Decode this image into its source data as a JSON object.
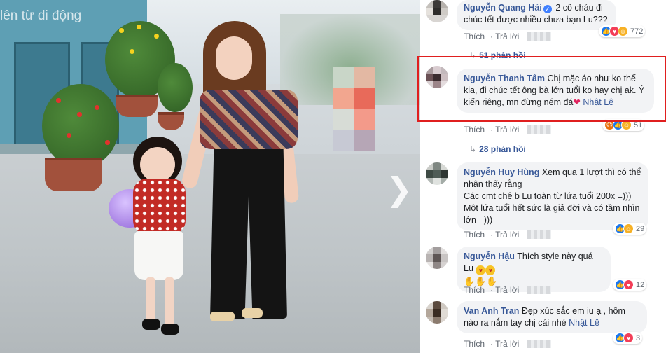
{
  "photo": {
    "caption": "lên từ di động",
    "next_arrow": "❯"
  },
  "comments": [
    {
      "author": "Nguyễn Quang Hải",
      "verified": true,
      "text": "2 cô cháu đi chúc tết được nhiều chưa bạn Lu???",
      "like_label": "Thích",
      "reply_label": "Trả lời",
      "reactions": [
        "like",
        "love",
        "haha"
      ],
      "reaction_count": "772",
      "replies_label": "51 phản hồi"
    },
    {
      "author": "Nguyễn Thanh Tâm",
      "text_before": "Chị mặc áo như ko thế kia, đi chúc tết ông bà lớn tuổi ko hay chị ak. Ý kiến riêng, mn đừng ném đá",
      "heart": "❤",
      "tag": "Nhật Lê",
      "like_label": "Thích",
      "reply_label": "Trả lời",
      "reactions": [
        "angry",
        "like",
        "haha"
      ],
      "reaction_count": "51",
      "replies_label": "28 phản hồi"
    },
    {
      "author": "Nguyễn Huy Hùng",
      "line1": "Xem qua 1 lượt thì có thể nhận thấy rằng",
      "line2": "Các cmt chê b Lu toàn từ lứa tuổi 200x =)))",
      "line3": "Một lứa tuổi hết sức là giả đời và có tầm nhìn lớn =)))",
      "like_label": "Thích",
      "reply_label": "Trả lời",
      "reactions": [
        "like",
        "haha"
      ],
      "reaction_count": "29"
    },
    {
      "author": "Nguyễn Hậu",
      "text": "Thích style này quá Lu",
      "like_label": "Thích",
      "reply_label": "Trả lời",
      "reactions": [
        "like",
        "love"
      ],
      "reaction_count": "12"
    },
    {
      "author": "Van Anh Tran",
      "text_before": "Đẹp xúc sắc em iu ạ , hôm nào ra nắm tay chị cái nhé",
      "tag": "Nhật Lê",
      "like_label": "Thích",
      "reply_label": "Trả lời",
      "reactions": [
        "like",
        "love"
      ],
      "reaction_count": "3"
    }
  ],
  "colors": {
    "highlight_border": "#e01f1f",
    "name_link": "#385898",
    "bubble_bg": "#f2f3f5"
  }
}
